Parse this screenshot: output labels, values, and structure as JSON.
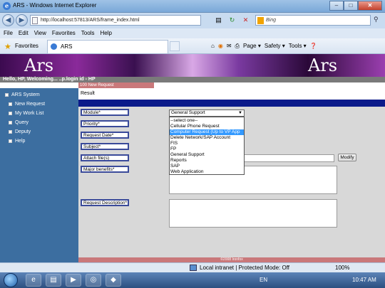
{
  "window": {
    "title": "ARS - Windows Internet Explorer",
    "minimize": "–",
    "maximize": "□",
    "close": "✕"
  },
  "address": {
    "url": "http://localhost:57813/ARS/frame_index.html",
    "search_placeholder": "Bing"
  },
  "menu": {
    "items": [
      "File",
      "Edit",
      "View",
      "Favorites",
      "Tools",
      "Help"
    ]
  },
  "favbar": {
    "favorites": "Favorites",
    "tab_label": "ARS",
    "commands": [
      "Page ▾",
      "Safety ▾",
      "Tools ▾"
    ]
  },
  "page": {
    "logo": "Ars",
    "welcome": "Hello, HP, Welcoming... ..p.login id - HP",
    "new_request_tab": "100 New Request",
    "sidebar": {
      "root": "ARS System",
      "items": [
        "New Request",
        "My Work List",
        "Query",
        "Deputy",
        "Help"
      ]
    },
    "result_label": "Result",
    "form": {
      "module_label": "Module*",
      "priority_label": "Priority*",
      "request_date_label": "Request Date*",
      "subject_label": "Subject*",
      "attach_label": "Attach file(s)",
      "benefits_label": "Major benefits*",
      "description_label": "Request Description*",
      "module_value": "General Support",
      "modify_button": "Modify"
    },
    "dropdown_options": [
      "--select one--",
      "Cellular Phone Request",
      "Computer Request (Up to VP App",
      "Delete Network/SAP Account",
      "FIS",
      "FP",
      "General Support",
      "Reports",
      "SAP",
      "Web Application"
    ],
    "dropdown_selected_index": 2,
    "footer": "©2008 Ironfox"
  },
  "status": {
    "zone": "Local intranet | Protected Mode: Off",
    "zoom": "100%"
  },
  "taskbar": {
    "language": "EN",
    "clock": "10:47 AM"
  }
}
